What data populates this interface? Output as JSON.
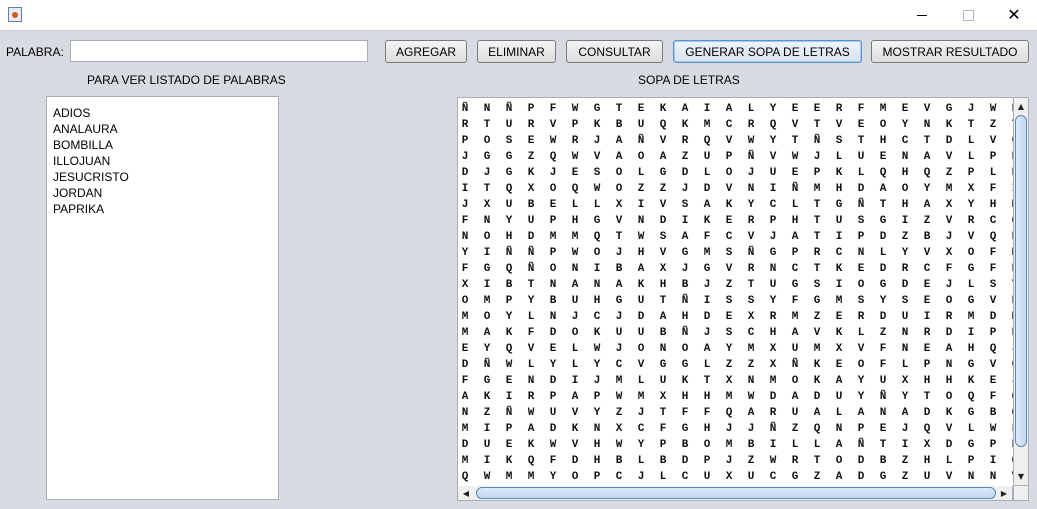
{
  "window": {
    "title": "",
    "controls": {
      "minimize": "–",
      "maximize": "□",
      "close": "✕"
    }
  },
  "form": {
    "word_label": "PALABRA:",
    "word_value": "",
    "buttons": {
      "add": "AGREGAR",
      "delete": "ELIMINAR",
      "query": "CONSULTAR",
      "generate": "GENERAR SOPA DE LETRAS",
      "show_result": "MOSTRAR RESULTADO"
    }
  },
  "word_list": {
    "header": "PARA VER LISTADO DE PALABRAS",
    "items": [
      "ADIOS",
      "ANALAURA",
      "BOMBILLA",
      "ILLOJUAN",
      "JESUCRISTO",
      "JORDAN",
      "PAPRIKA"
    ]
  },
  "grid": {
    "header": "SOPA DE LETRAS",
    "rows": [
      "ÑNÑPFWGTEKAIALYEERFMEVGJWB",
      "RTURVPKBUQKMCRQVTVEOYNKTZT",
      "POSEWRJAÑVRQVWYTÑSTHCTDLVG",
      "JGGZQWVAOAZUPÑVWJLUENAVLPR",
      "DJGKJESOLGDLOJUEPKLQHQZPLB",
      "ITQXOQWOZZJDVNIÑMHDAOYMXFI",
      "JXUBELLXIVSAKYCLTGÑTHAXYHM",
      "FNYUPHGVNDIKERPHTUSGIZVRCQ",
      "NOHDMMQTWSAFCVJATIPDZBJVQR",
      "YIÑÑPWOJHVGMSÑGPRCNLYVXOFM",
      "FGQÑONIBAXJGVRNCTKEDRCFGFP",
      "XIBTNANAKHBJZTUGSIOGDEJLSY",
      "OMPYBUHGUTÑISSYFGMSYSEOGVN",
      "MOYLNJCJDAHDEXRMZERDUIRMDM",
      "MAKFDOKUUBÑJSCHAVKLZNRDIPE",
      "EYQVELWJONOAYMXUMXVFNEAHQJ",
      "DÑWLYLYCVGGLZZXÑKEOFLPNGVC",
      "FGENDIJMLUKTXNMOKAYUXHHKEJ",
      "AKIRPAPWMXHHMWDADUYÑYTOQFQ",
      "NZÑWUVYZJTFFQARUALANADKGBQ",
      "MIPADKNXCFGHJJÑZQNPEJQVLWFH",
      "DUEKWVHWYPBOMBILLAÑTIXDGPE",
      "MIKQFDHBLBDPJZWRTODBZHLPIO",
      "QWMMYOPCJLCUXUCGZADGZUVNNV"
    ]
  },
  "colors": {
    "background": "#d8dbe2",
    "titlebar": "#ffffff",
    "scroll_thumb": "#c3d8ef"
  }
}
